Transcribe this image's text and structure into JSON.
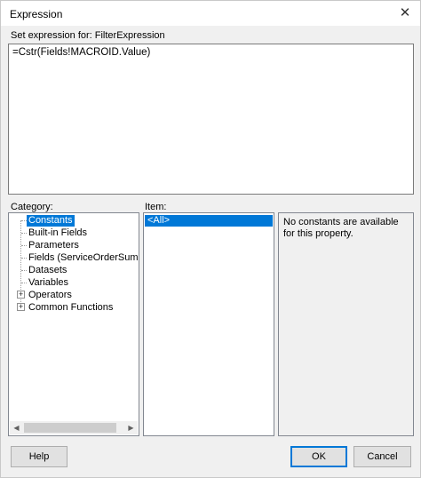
{
  "window": {
    "title": "Expression",
    "close_glyph": "✕"
  },
  "expression": {
    "label": "Set expression for: FilterExpression",
    "value": "=Cstr(Fields!MACROID.Value)"
  },
  "category": {
    "label": "Category:",
    "items": [
      {
        "label": "Constants",
        "selected": true,
        "expandable": false
      },
      {
        "label": "Built-in Fields",
        "expandable": false
      },
      {
        "label": "Parameters",
        "expandable": false
      },
      {
        "label": "Fields (ServiceOrderSummar",
        "expandable": false
      },
      {
        "label": "Datasets",
        "expandable": false
      },
      {
        "label": "Variables",
        "expandable": false
      },
      {
        "label": "Operators",
        "expandable": true
      },
      {
        "label": "Common Functions",
        "expandable": true
      }
    ],
    "scroll_left": "◀",
    "scroll_right": "▶"
  },
  "item": {
    "label": "Item:",
    "items": [
      "<All>"
    ]
  },
  "description": {
    "text": "No constants are available for this property."
  },
  "buttons": {
    "help": "Help",
    "ok": "OK",
    "cancel": "Cancel"
  },
  "colors": {
    "selection": "#0078d7",
    "dialog_bg": "#f0f0f0"
  }
}
